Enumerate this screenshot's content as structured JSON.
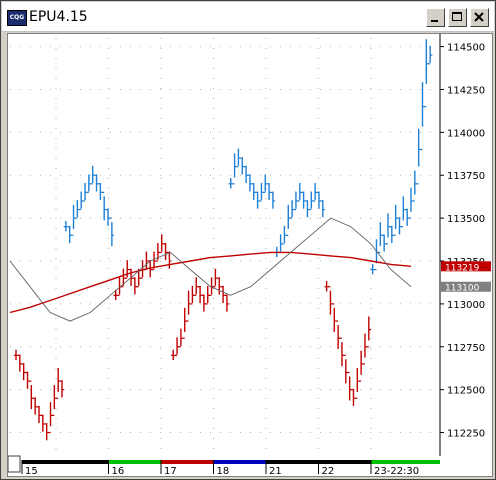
{
  "window": {
    "title": "EPU4.15",
    "icon": "cqg-app-icon",
    "buttons": [
      "minimize-icon",
      "maximize-icon",
      "close-icon"
    ]
  },
  "chart_data": {
    "type": "bar",
    "chart_style": "hlc-bars",
    "symbol": "EPU4.15",
    "x_session_labels": [
      "15",
      "16",
      "17",
      "18",
      "21",
      "22",
      "23-22:30"
    ],
    "session_bar_colors": [
      "#000000",
      "#00c000",
      "#c00000",
      "#0000c0",
      "#000000",
      "#000000",
      "#00c000"
    ],
    "y_ticks": [
      112250,
      112500,
      112750,
      113000,
      113250,
      113500,
      113750,
      114000,
      114250,
      114500
    ],
    "y_tick_labels": [
      "112250",
      "112500",
      "112750",
      "113000",
      "113250",
      "113500",
      "113750",
      "114000",
      "114250",
      "114500"
    ],
    "ylim": [
      112125,
      114550
    ],
    "grid": "dotted",
    "price_markers": [
      {
        "value": 113219,
        "label": "113219",
        "color": "#c00000"
      },
      {
        "value": 113100,
        "label": "113100",
        "color": "#808080"
      }
    ],
    "bar_colors": {
      "up": "#1e7fd6",
      "down": "#c00000",
      "neutral": "#404040"
    },
    "series": [
      {
        "kind": "hlc-bars",
        "segment": "session-15",
        "color": "#c00000",
        "close": [
          112700,
          112650,
          112600,
          112550,
          112450,
          112400,
          112350,
          112300,
          112250,
          112350,
          112450,
          112550,
          112500
        ]
      },
      {
        "kind": "hlc-bars",
        "segment": "session-15-16",
        "color": "#1e7fd6",
        "close": [
          113450,
          113400,
          113500,
          113550,
          113600,
          113650,
          113700,
          113750,
          113700,
          113650,
          113550,
          113500,
          113400
        ]
      },
      {
        "kind": "hlc-bars",
        "segment": "session-16-17",
        "color": "#c00000",
        "close": [
          113050,
          113100,
          113150,
          113200,
          113150,
          113100,
          113150,
          113200,
          113250,
          113200,
          113250,
          113300,
          113350,
          113300,
          113250
        ]
      },
      {
        "kind": "hlc-bars",
        "segment": "session-17",
        "color": "#c00000",
        "close": [
          112700,
          112750,
          112800,
          112900,
          113000,
          113050,
          113100,
          113050,
          113000,
          113050,
          113100,
          113150,
          113100,
          113050,
          113000
        ]
      },
      {
        "kind": "hlc-bars",
        "segment": "session-18",
        "color": "#1e7fd6",
        "close": [
          113700,
          113800,
          113850,
          113800,
          113750,
          113700,
          113650,
          113600,
          113650,
          113700,
          113650,
          113600
        ]
      },
      {
        "kind": "hlc-bars",
        "segment": "session-21",
        "color": "#1e7fd6",
        "close": [
          113300,
          113350,
          113400,
          113500,
          113550,
          113600,
          113650,
          113600,
          113550,
          113600,
          113650,
          113600,
          113550
        ]
      },
      {
        "kind": "hlc-bars",
        "segment": "session-22",
        "color": "#c00000",
        "close": [
          113100,
          113000,
          112900,
          112800,
          112700,
          112600,
          112500,
          112450,
          112550,
          112650,
          112750,
          112850
        ]
      },
      {
        "kind": "hlc-bars",
        "segment": "session-23",
        "color": "#1e7fd6",
        "close": [
          113200,
          113300,
          113400,
          113350,
          113450,
          113400,
          113500,
          113450,
          113550,
          113500,
          113600,
          113700,
          113900,
          114150,
          114400,
          114450
        ]
      },
      {
        "kind": "moving-average-long",
        "color": "#c00000",
        "value": [
          112950,
          112980,
          113020,
          113060,
          113100,
          113140,
          113180,
          113210,
          113230,
          113250,
          113270,
          113280,
          113290,
          113300,
          113300,
          113290,
          113280,
          113270,
          113250,
          113230,
          113219
        ]
      },
      {
        "kind": "moving-average-short",
        "color": "#606060",
        "value": [
          113250,
          113100,
          112950,
          112900,
          112950,
          113050,
          113150,
          113250,
          113300,
          113200,
          113100,
          113050,
          113100,
          113200,
          113300,
          113400,
          113500,
          113450,
          113350,
          113200,
          113100
        ]
      }
    ]
  }
}
